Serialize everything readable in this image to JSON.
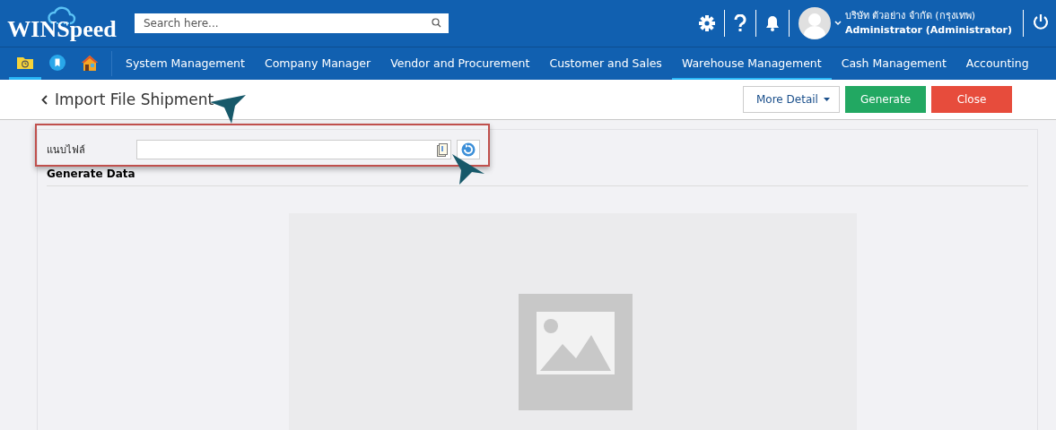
{
  "header": {
    "logo": "WINSpeed",
    "search": {
      "placeholder": "Search here..."
    },
    "company": "บริษัท ตัวอย่าง จำกัด (กรุงเทพ)",
    "user": "Administrator (Administrator)"
  },
  "quick_icons": [
    {
      "kind": "folder",
      "selected": true
    },
    {
      "kind": "bookmark",
      "selected": false
    },
    {
      "kind": "home",
      "selected": false
    }
  ],
  "menu": [
    {
      "label": "System Management",
      "selected": false
    },
    {
      "label": "Company Manager",
      "selected": false
    },
    {
      "label": "Vendor and Procurement",
      "selected": false
    },
    {
      "label": "Customer and Sales",
      "selected": false
    },
    {
      "label": "Warehouse Management",
      "selected": true
    },
    {
      "label": "Cash Management",
      "selected": false
    },
    {
      "label": "Accounting",
      "selected": false
    }
  ],
  "page": {
    "title": "Import File Shipment",
    "buttons": [
      {
        "label": "More Detail",
        "kind": "dropdown"
      },
      {
        "label": "Generate",
        "kind": "primary"
      },
      {
        "label": "Close",
        "kind": "danger"
      }
    ]
  },
  "form": {
    "attach_label": "แนบไฟล์",
    "section": "Generate Data"
  }
}
